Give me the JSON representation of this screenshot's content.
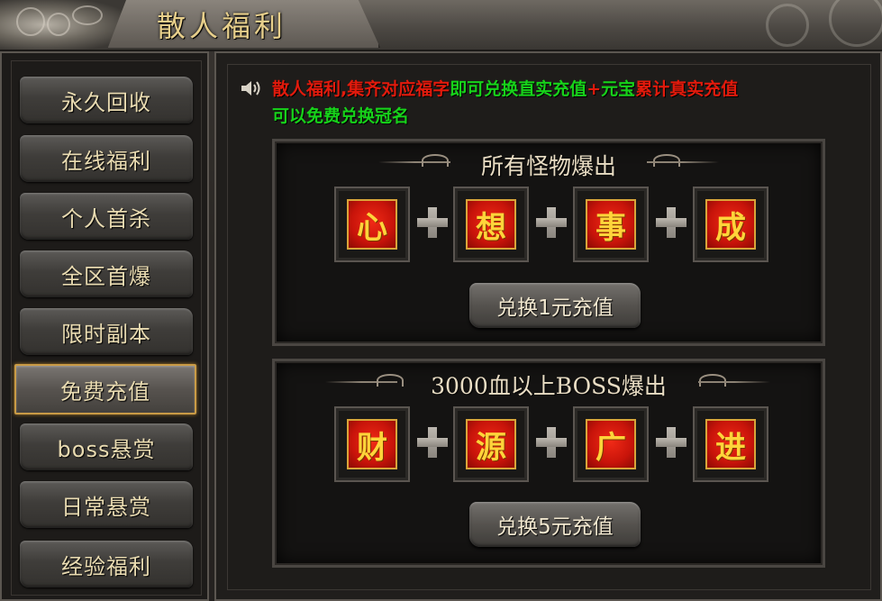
{
  "window": {
    "title": "散人福利"
  },
  "sidebar": {
    "items": [
      {
        "label": "永久回收",
        "active": false
      },
      {
        "label": "在线福利",
        "active": false
      },
      {
        "label": "个人首杀",
        "active": false
      },
      {
        "label": "全区首爆",
        "active": false
      },
      {
        "label": "限时副本",
        "active": false
      },
      {
        "label": "免费充值",
        "active": true
      },
      {
        "label": "boss悬赏",
        "active": false
      },
      {
        "label": "日常悬赏",
        "active": false
      },
      {
        "label": "经验福利",
        "active": false
      }
    ]
  },
  "notice": {
    "icon": "speaker-icon",
    "parts": [
      {
        "text": "散人福利,集齐对应福字",
        "color": "red"
      },
      {
        "text": "即可兑换",
        "color": "green"
      },
      {
        "text": "直实充值",
        "color": "red"
      },
      {
        "text": "+",
        "color": "green"
      },
      {
        "text": "元宝",
        "color": "red"
      },
      {
        "text": "累计真实充值",
        "color": "red"
      },
      {
        "text": "可以免费兑换冠名",
        "color": "green"
      }
    ]
  },
  "sections": [
    {
      "title": "所有怪物爆出",
      "tiles": [
        "心",
        "想",
        "事",
        "成"
      ],
      "button": "兑换1元充值"
    },
    {
      "title": "3000血以上BOSS爆出",
      "tiles": [
        "财",
        "源",
        "广",
        "进"
      ],
      "button": "兑换5元充值"
    }
  ],
  "colors": {
    "notice_red": "#e21a0c",
    "notice_green": "#17d21a",
    "tile_red": "#d8180c",
    "tile_gold": "#ffd43a",
    "active_border": "#c99b46",
    "title_gold": "#e7cf8b"
  }
}
